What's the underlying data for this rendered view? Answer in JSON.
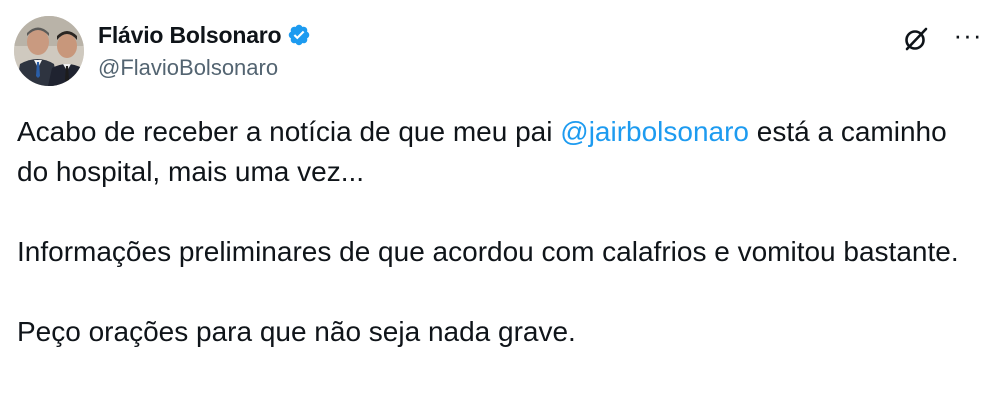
{
  "author": {
    "display_name": "Flávio Bolsonaro",
    "handle": "@FlavioBolsonaro",
    "verified_icon": "verified-badge-icon",
    "verified_color": "#1d9bf0"
  },
  "actions": {
    "grok_icon": "grok-icon",
    "more_icon": "more-options-icon",
    "more_label": "···"
  },
  "tweet": {
    "p1_before": "Acabo de receber a notícia de que meu pai ",
    "p1_mention": "@jairbolsonaro",
    "p1_after": " está a caminho do hospital, mais uma vez...",
    "p2": "Informações preliminares de que acordou com calafrios e vomitou bastante.",
    "p3": "Peço orações para que não seja nada grave."
  },
  "colors": {
    "text": "#0f1419",
    "secondary": "#536471",
    "link": "#1d9bf0"
  }
}
